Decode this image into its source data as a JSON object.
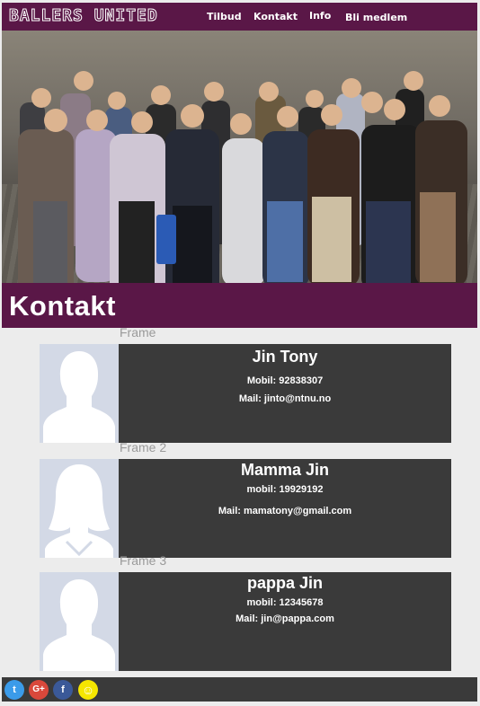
{
  "nav": {
    "logo": "BALLERS UNITED",
    "links": [
      "Tilbud",
      "Kontakt",
      "Info",
      "Bli medlem"
    ]
  },
  "hero": {
    "image": "group-photo"
  },
  "page_title": "Kontakt",
  "contacts": [
    {
      "frame_label": "Frame",
      "name": "Jin Tony",
      "phone": "Mobil: 92838307",
      "mail": "Mail: jinto@ntnu.no",
      "avatar": "male-avatar-icon"
    },
    {
      "frame_label": "Frame 2",
      "name": "Mamma Jin",
      "phone": "mobil: 19929192",
      "mail": "Mail: mamatony@gmail.com",
      "avatar": "female-avatar-icon"
    },
    {
      "frame_label": "Frame 3",
      "name": "pappa Jin",
      "phone": "mobil: 12345678",
      "mail": "Mail: jin@pappa.com",
      "avatar": "male-avatar-icon"
    }
  ],
  "footer": {
    "social": [
      {
        "icon": "twitter-icon",
        "glyph": "t",
        "color": "#3b9be9"
      },
      {
        "icon": "google-plus-icon",
        "glyph": "G+",
        "color": "#d9483b"
      },
      {
        "icon": "facebook-icon",
        "glyph": "f",
        "color": "#3b5998"
      },
      {
        "icon": "snapchat-icon",
        "glyph": "☺",
        "color": "#f5e600"
      }
    ]
  }
}
